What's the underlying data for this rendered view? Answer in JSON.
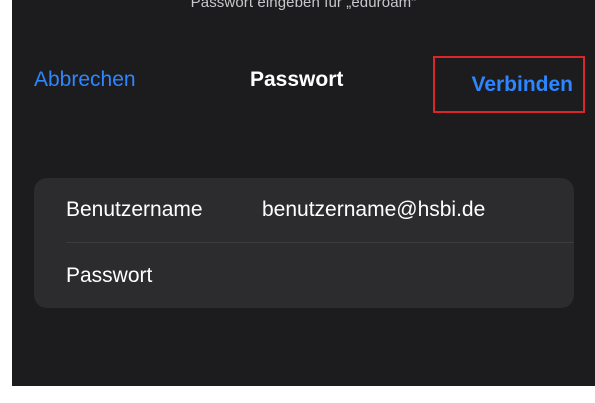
{
  "prompt": "Passwort eingeben für „eduroam“",
  "nav": {
    "cancel_label": "Abbrechen",
    "title": "Passwort",
    "connect_label": "Verbinden"
  },
  "form": {
    "username_label": "Benutzername",
    "username_value": "benutzername@hsbi.de",
    "password_label": "Passwort",
    "password_value": ""
  },
  "colors": {
    "background": "#1c1c1e",
    "card": "#2c2c2e",
    "accent": "#2d86ff",
    "highlight_border": "#d8262b"
  }
}
